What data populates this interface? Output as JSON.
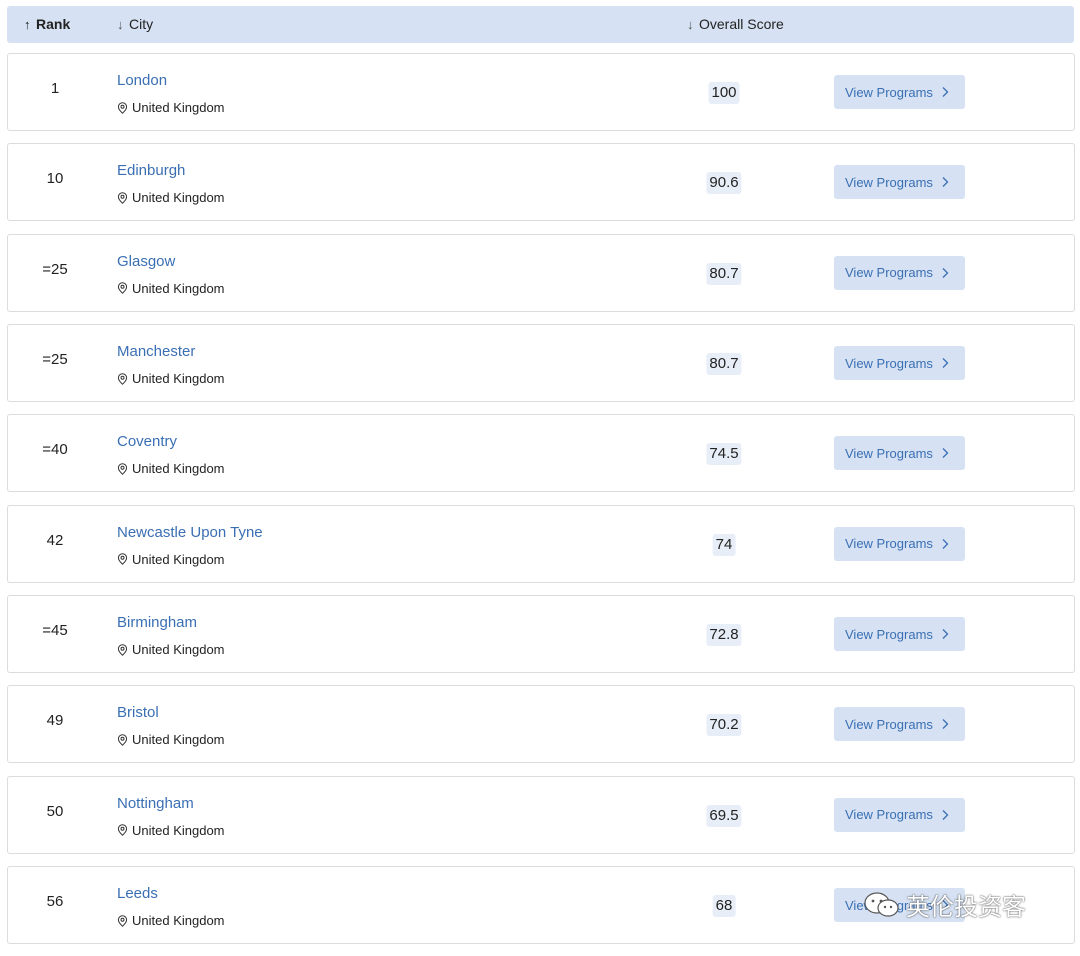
{
  "header": {
    "rank_label": "Rank",
    "city_label": "City",
    "score_label": "Overall Score",
    "rank_sort_icon": "arrow-up-icon",
    "city_sort_icon": "arrow-down-icon",
    "score_sort_icon": "arrow-down-icon"
  },
  "button_label": "View Programs",
  "rows": [
    {
      "rank": "1",
      "city": "London",
      "country": "United Kingdom",
      "score": "100"
    },
    {
      "rank": "10",
      "city": "Edinburgh",
      "country": "United Kingdom",
      "score": "90.6"
    },
    {
      "rank": "=25",
      "city": "Glasgow",
      "country": "United Kingdom",
      "score": "80.7"
    },
    {
      "rank": "=25",
      "city": "Manchester",
      "country": "United Kingdom",
      "score": "80.7"
    },
    {
      "rank": "=40",
      "city": "Coventry",
      "country": "United Kingdom",
      "score": "74.5"
    },
    {
      "rank": "42",
      "city": "Newcastle Upon Tyne",
      "country": "United Kingdom",
      "score": "74"
    },
    {
      "rank": "=45",
      "city": "Birmingham",
      "country": "United Kingdom",
      "score": "72.8"
    },
    {
      "rank": "49",
      "city": "Bristol",
      "country": "United Kingdom",
      "score": "70.2"
    },
    {
      "rank": "50",
      "city": "Nottingham",
      "country": "United Kingdom",
      "score": "69.5"
    },
    {
      "rank": "56",
      "city": "Leeds",
      "country": "United Kingdom",
      "score": "68"
    }
  ],
  "watermark": {
    "text": "英伦投资客",
    "icon": "wechat-icon"
  },
  "colors": {
    "header_bg": "#d6e2f3",
    "link": "#3a6fb4",
    "button_bg": "#d6e2f3",
    "score_bg": "#e8eef7",
    "row_border": "#dcdcdc"
  }
}
